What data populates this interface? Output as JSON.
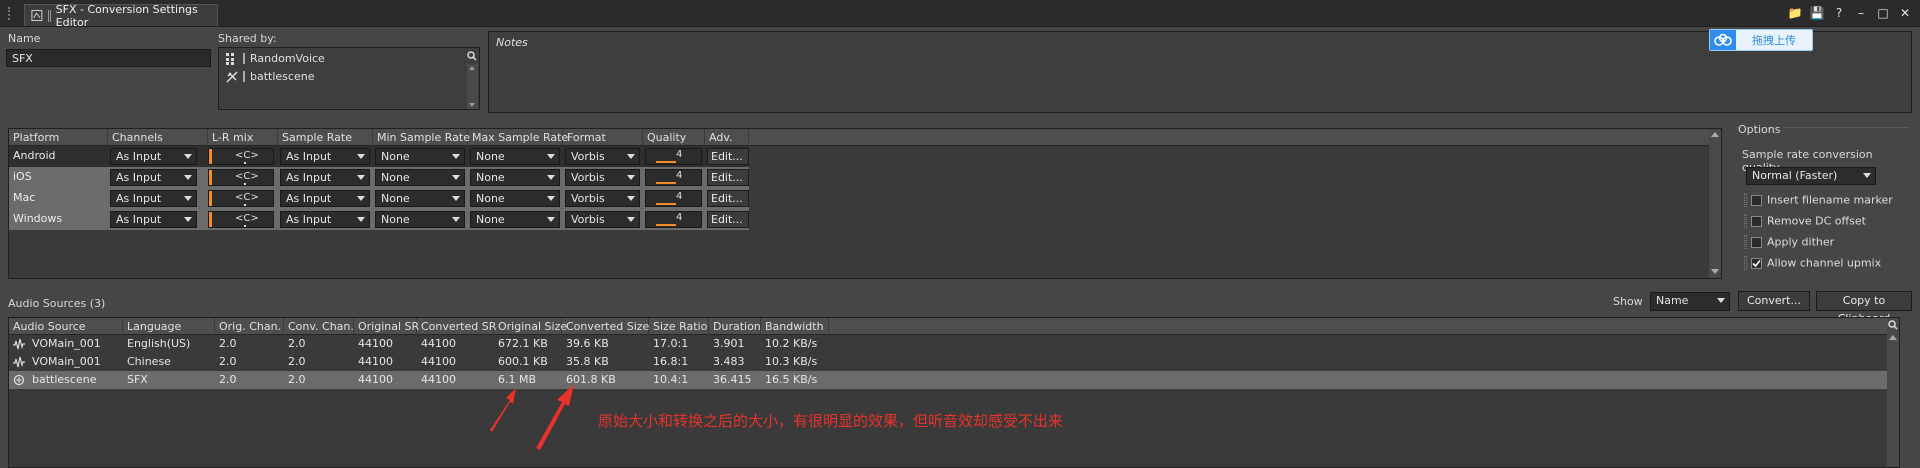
{
  "window": {
    "tab_title": "SFX - Conversion Settings Editor"
  },
  "name_label": "Name",
  "name_value": "SFX",
  "shared_label": "Shared by:",
  "shared_items": [
    "RandomVoice",
    "battlescene"
  ],
  "notes_label": "Notes",
  "upload_button": "拖拽上传",
  "platform_table": {
    "headers": [
      "Platform",
      "Channels",
      "L-R mix",
      "Sample Rate",
      "Min Sample Rate",
      "Max Sample Rate",
      "Format",
      "Quality",
      "Adv."
    ],
    "rows": [
      {
        "platform": "Android",
        "channels": "As Input",
        "lr": "<C>",
        "sample_rate": "As Input",
        "min_sr": "None",
        "max_sr": "None",
        "format": "Vorbis",
        "quality": "4",
        "adv": "Edit..."
      },
      {
        "platform": "iOS",
        "channels": "As Input",
        "lr": "<C>",
        "sample_rate": "As Input",
        "min_sr": "None",
        "max_sr": "None",
        "format": "Vorbis",
        "quality": "4",
        "adv": "Edit..."
      },
      {
        "platform": "Mac",
        "channels": "As Input",
        "lr": "<C>",
        "sample_rate": "As Input",
        "min_sr": "None",
        "max_sr": "None",
        "format": "Vorbis",
        "quality": "4",
        "adv": "Edit..."
      },
      {
        "platform": "Windows",
        "channels": "As Input",
        "lr": "<C>",
        "sample_rate": "As Input",
        "min_sr": "None",
        "max_sr": "None",
        "format": "Vorbis",
        "quality": "4",
        "adv": "Edit..."
      }
    ]
  },
  "options": {
    "title": "Options",
    "src_quality_label": "Sample rate conversion quality",
    "src_quality_value": "Normal (Faster)",
    "checks": [
      {
        "label": "Insert filename marker",
        "checked": false
      },
      {
        "label": "Remove DC offset",
        "checked": false
      },
      {
        "label": "Apply dither",
        "checked": false
      },
      {
        "label": "Allow channel upmix",
        "checked": true
      }
    ]
  },
  "audio_sources": {
    "title": "Audio Sources (3)",
    "show_label": "Show",
    "show_value": "Name",
    "convert_button": "Convert...",
    "copy_button": "Copy to Clipboard",
    "headers": [
      "Audio Source",
      "Language",
      "Orig. Chan.",
      "Conv. Chan.",
      "Original SR",
      "Converted SR",
      "Original Size",
      "Converted Size",
      "Size Ratio",
      "Duration",
      "Bandwidth"
    ],
    "rows": [
      [
        "VOMain_001",
        "English(US)",
        "2.0",
        "2.0",
        "44100",
        "44100",
        "672.1 KB",
        "39.6 KB",
        "17.0:1",
        "3.901",
        "10.2 KB/s"
      ],
      [
        "VOMain_001",
        "Chinese",
        "2.0",
        "2.0",
        "44100",
        "44100",
        "600.1 KB",
        "35.8 KB",
        "16.8:1",
        "3.483",
        "10.3 KB/s"
      ],
      [
        "battlescene",
        "SFX",
        "2.0",
        "2.0",
        "44100",
        "44100",
        "6.1 MB",
        "601.8 KB",
        "10.4:1",
        "36.415",
        "16.5 KB/s"
      ]
    ]
  },
  "annotation": "原始大小和转换之后的大小，有很明显的效果，但听音效却感受不出来",
  "colors": {
    "annotation": "#e8322a",
    "accent": "#f28c28",
    "selection": "#6b6b6b"
  }
}
